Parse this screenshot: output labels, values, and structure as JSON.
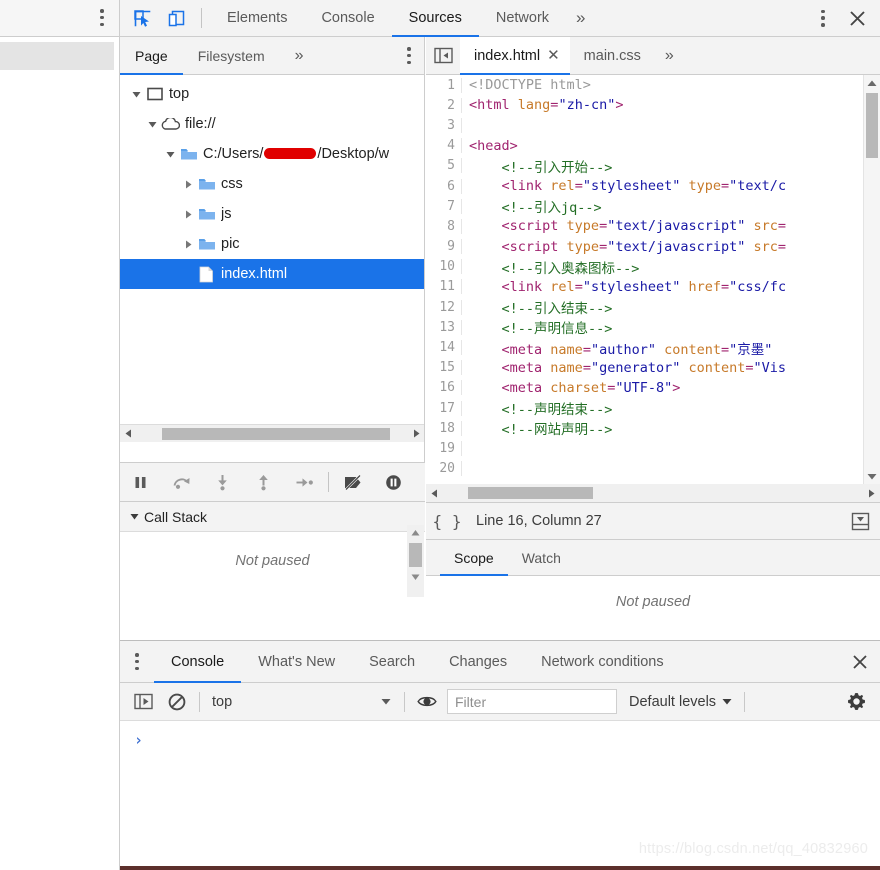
{
  "window": {
    "title": "Chrome DevTools - Sources"
  },
  "main_tabbar": {
    "inspect_icon": "inspect-element-icon",
    "device_icon": "device-toolbar-icon",
    "tabs": [
      {
        "label": "Elements",
        "active": false
      },
      {
        "label": "Console",
        "active": false
      },
      {
        "label": "Sources",
        "active": true
      },
      {
        "label": "Network",
        "active": false
      }
    ],
    "more_label": "»",
    "kebab_icon": "main-menu-icon",
    "close_icon": "close-devtools-icon"
  },
  "navigator": {
    "tabs": [
      {
        "label": "Page",
        "active": true
      },
      {
        "label": "Filesystem",
        "active": false
      }
    ],
    "more_label": "»",
    "kebab_icon": "navigator-menu-icon",
    "tree": [
      {
        "label": "top",
        "icon": "frame-icon",
        "depth": 0,
        "twisty": "expanded",
        "selected": false,
        "redacted": false
      },
      {
        "label": "file://",
        "icon": "cloud-icon",
        "depth": 1,
        "twisty": "expanded",
        "selected": false,
        "redacted": false
      },
      {
        "label_before": "C:/Users/",
        "label_after": "/Desktop/w",
        "icon": "folder-icon",
        "depth": 2,
        "twisty": "expanded",
        "selected": false,
        "redacted": true
      },
      {
        "label": "css",
        "icon": "folder-icon",
        "depth": 3,
        "twisty": "collapsed",
        "selected": false,
        "redacted": false
      },
      {
        "label": "js",
        "icon": "folder-icon",
        "depth": 3,
        "twisty": "collapsed",
        "selected": false,
        "redacted": false
      },
      {
        "label": "pic",
        "icon": "folder-icon",
        "depth": 3,
        "twisty": "collapsed",
        "selected": false,
        "redacted": false
      },
      {
        "label": "index.html",
        "icon": "file-document-icon",
        "depth": 3,
        "twisty": "none",
        "selected": true,
        "redacted": false
      }
    ]
  },
  "debugger_toolbar": {
    "buttons": [
      {
        "name": "pause-resume-script",
        "icon": "pause-icon"
      },
      {
        "name": "step-over",
        "icon": "step-over-icon"
      },
      {
        "name": "step-into",
        "icon": "step-into-icon"
      },
      {
        "name": "step-out",
        "icon": "step-out-icon"
      },
      {
        "name": "step",
        "icon": "step-icon"
      },
      {
        "name": "deactivate-breakpoints",
        "icon": "deactivate-breakpoints-icon"
      },
      {
        "name": "pause-on-exceptions",
        "icon": "pause-on-exceptions-icon"
      }
    ]
  },
  "call_stack": {
    "title": "Call Stack",
    "empty_message": "Not paused"
  },
  "editor": {
    "panel_toggle_icon": "show-navigator-icon",
    "tabs": [
      {
        "label": "index.html",
        "active": true,
        "closable": true
      },
      {
        "label": "main.css",
        "active": false,
        "closable": false
      }
    ],
    "more_label": "»",
    "status": {
      "format_icon": "pretty-print-icon",
      "position": "Line 16, Column 27",
      "drawer_icon": "show-drawer-icon"
    },
    "code_lines": [
      {
        "n": 1,
        "tokens": [
          {
            "t": "doctype",
            "s": "<!DOCTYPE html>"
          }
        ]
      },
      {
        "n": 2,
        "tokens": [
          {
            "t": "tag",
            "s": "<html "
          },
          {
            "t": "attr",
            "s": "lang"
          },
          {
            "t": "punct",
            "s": "="
          },
          {
            "t": "val",
            "s": "\"zh-cn\""
          },
          {
            "t": "tag",
            "s": ">"
          }
        ]
      },
      {
        "n": 3,
        "tokens": []
      },
      {
        "n": 4,
        "tokens": [
          {
            "t": "tag",
            "s": "<head>"
          }
        ]
      },
      {
        "n": 5,
        "tokens": [
          {
            "t": "comment",
            "s": "    <!--引入开始-->"
          }
        ]
      },
      {
        "n": 6,
        "tokens": [
          {
            "t": "plain",
            "s": "    "
          },
          {
            "t": "tag",
            "s": "<link "
          },
          {
            "t": "attr",
            "s": "rel"
          },
          {
            "t": "punct",
            "s": "="
          },
          {
            "t": "val",
            "s": "\"stylesheet\""
          },
          {
            "t": "plain",
            "s": " "
          },
          {
            "t": "attr",
            "s": "type"
          },
          {
            "t": "punct",
            "s": "="
          },
          {
            "t": "val",
            "s": "\"text/c"
          }
        ]
      },
      {
        "n": 7,
        "tokens": [
          {
            "t": "comment",
            "s": "    <!--引入jq-->"
          }
        ]
      },
      {
        "n": 8,
        "tokens": [
          {
            "t": "plain",
            "s": "    "
          },
          {
            "t": "tag",
            "s": "<script "
          },
          {
            "t": "attr",
            "s": "type"
          },
          {
            "t": "punct",
            "s": "="
          },
          {
            "t": "val",
            "s": "\"text/javascript\""
          },
          {
            "t": "plain",
            "s": " "
          },
          {
            "t": "attr",
            "s": "src"
          },
          {
            "t": "punct",
            "s": "="
          }
        ]
      },
      {
        "n": 9,
        "tokens": [
          {
            "t": "plain",
            "s": "    "
          },
          {
            "t": "tag",
            "s": "<script "
          },
          {
            "t": "attr",
            "s": "type"
          },
          {
            "t": "punct",
            "s": "="
          },
          {
            "t": "val",
            "s": "\"text/javascript\""
          },
          {
            "t": "plain",
            "s": " "
          },
          {
            "t": "attr",
            "s": "src"
          },
          {
            "t": "punct",
            "s": "="
          }
        ]
      },
      {
        "n": 10,
        "tokens": [
          {
            "t": "comment",
            "s": "    <!--引入奥森图标-->"
          }
        ]
      },
      {
        "n": 11,
        "tokens": [
          {
            "t": "plain",
            "s": "    "
          },
          {
            "t": "tag",
            "s": "<link "
          },
          {
            "t": "attr",
            "s": "rel"
          },
          {
            "t": "punct",
            "s": "="
          },
          {
            "t": "val",
            "s": "\"stylesheet\""
          },
          {
            "t": "plain",
            "s": " "
          },
          {
            "t": "attr",
            "s": "href"
          },
          {
            "t": "punct",
            "s": "="
          },
          {
            "t": "val",
            "s": "\"css/fc"
          }
        ]
      },
      {
        "n": 12,
        "tokens": [
          {
            "t": "comment",
            "s": "    <!--引入结束-->"
          }
        ]
      },
      {
        "n": 13,
        "tokens": [
          {
            "t": "comment",
            "s": "    <!--声明信息-->"
          }
        ]
      },
      {
        "n": 14,
        "tokens": [
          {
            "t": "plain",
            "s": "    "
          },
          {
            "t": "tag",
            "s": "<meta "
          },
          {
            "t": "attr",
            "s": "name"
          },
          {
            "t": "punct",
            "s": "="
          },
          {
            "t": "val",
            "s": "\"author\""
          },
          {
            "t": "plain",
            "s": " "
          },
          {
            "t": "attr",
            "s": "content"
          },
          {
            "t": "punct",
            "s": "="
          },
          {
            "t": "val",
            "s": "\"京墨\""
          }
        ]
      },
      {
        "n": 15,
        "tokens": [
          {
            "t": "plain",
            "s": "    "
          },
          {
            "t": "tag",
            "s": "<meta "
          },
          {
            "t": "attr",
            "s": "name"
          },
          {
            "t": "punct",
            "s": "="
          },
          {
            "t": "val",
            "s": "\"generator\""
          },
          {
            "t": "plain",
            "s": " "
          },
          {
            "t": "attr",
            "s": "content"
          },
          {
            "t": "punct",
            "s": "="
          },
          {
            "t": "val",
            "s": "\"Vis"
          }
        ]
      },
      {
        "n": 16,
        "tokens": [
          {
            "t": "plain",
            "s": "    "
          },
          {
            "t": "tag",
            "s": "<meta "
          },
          {
            "t": "attr",
            "s": "charset"
          },
          {
            "t": "punct",
            "s": "="
          },
          {
            "t": "val",
            "s": "\"UTF-8\""
          },
          {
            "t": "tag",
            "s": ">"
          }
        ]
      },
      {
        "n": 17,
        "tokens": [
          {
            "t": "comment",
            "s": "    <!--声明结束-->"
          }
        ]
      },
      {
        "n": 18,
        "tokens": [
          {
            "t": "comment",
            "s": "    <!--网站声明-->"
          }
        ]
      },
      {
        "n": 19,
        "tokens": []
      },
      {
        "n": 20,
        "tokens": []
      }
    ]
  },
  "scope_pane": {
    "tabs": [
      {
        "label": "Scope",
        "active": true
      },
      {
        "label": "Watch",
        "active": false
      }
    ],
    "empty_message": "Not paused"
  },
  "drawer": {
    "kebab_icon": "drawer-menu-icon",
    "tabs": [
      {
        "label": "Console",
        "active": true
      },
      {
        "label": "What's New",
        "active": false
      },
      {
        "label": "Search",
        "active": false
      },
      {
        "label": "Changes",
        "active": false
      },
      {
        "label": "Network conditions",
        "active": false
      }
    ],
    "close_icon": "close-drawer-icon",
    "toolbar": {
      "sidebar_icon": "console-sidebar-icon",
      "clear_icon": "clear-console-icon",
      "context": "top",
      "eye_icon": "live-expression-icon",
      "filter_placeholder": "Filter",
      "filter_value": "",
      "levels_label": "Default levels",
      "gear_icon": "console-settings-icon"
    },
    "prompt_caret": "›"
  },
  "watermark": {
    "text": "https://blog.csdn.net/qq_40832960"
  },
  "colors": {
    "accent": "#1a73e8",
    "selection": "#1a73e8",
    "redaction": "#e00000",
    "toolbar_bg": "#f3f3f3",
    "syntax_tag": "#a0246f",
    "syntax_attr": "#c77a2a",
    "syntax_value": "#1a1aa6",
    "syntax_comment": "#236e25",
    "syntax_doctype": "#999999"
  }
}
